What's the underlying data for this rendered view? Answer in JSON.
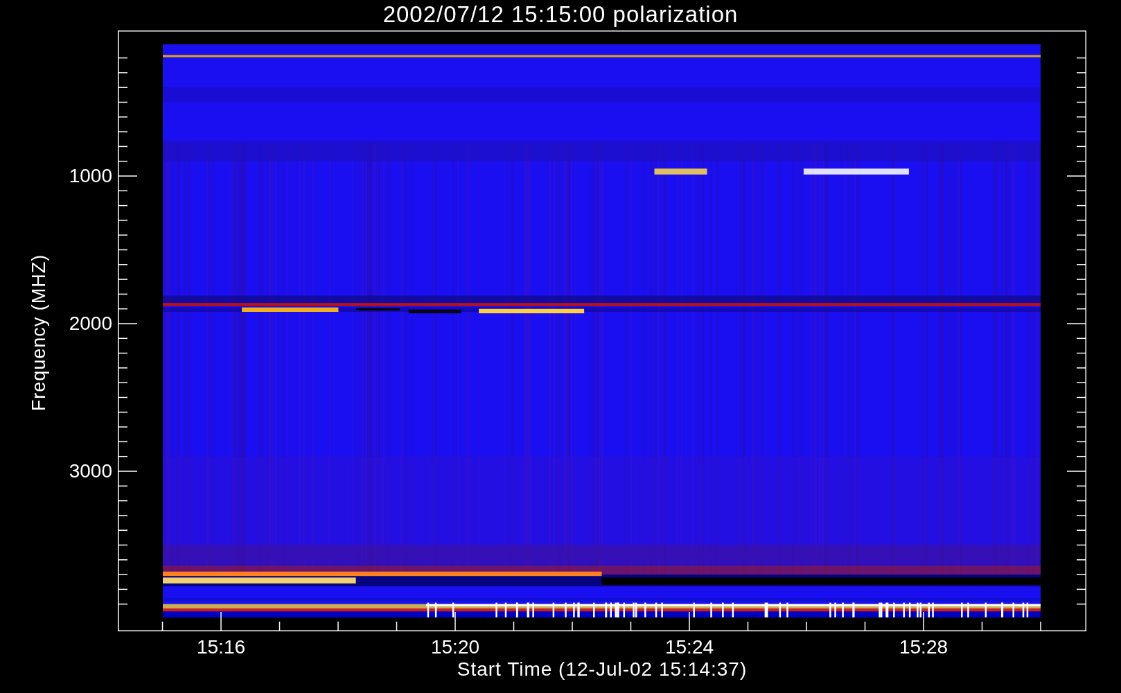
{
  "title": "2002/07/12 15:15:00 polarization",
  "chart": {
    "ylabel": "Frequency (MHZ)",
    "xlabel": "Start Time (12-Jul-02 15:14:37)",
    "yticks": [
      "1000",
      "2000",
      "3000"
    ],
    "xticks": [
      "15:16",
      "15:20",
      "15:24",
      "15:28"
    ]
  }
}
